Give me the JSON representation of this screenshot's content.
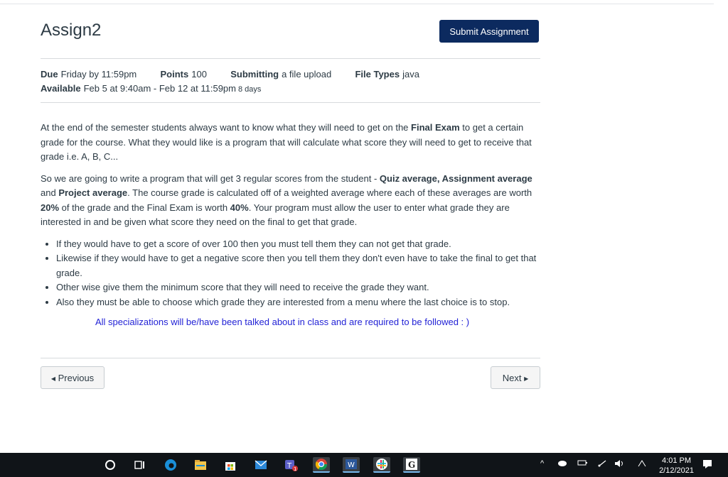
{
  "assignment": {
    "title": "Assign2",
    "submit_label": "Submit Assignment"
  },
  "details": {
    "due_label": "Due",
    "due_value": "Friday by 11:59pm",
    "points_label": "Points",
    "points_value": "100",
    "submitting_label": "Submitting",
    "submitting_value": "a file upload",
    "filetypes_label": "File Types",
    "filetypes_value": "java",
    "available_label": "Available",
    "available_value": "Feb 5 at 9:40am - Feb 12 at 11:59pm",
    "available_days": "8 days"
  },
  "body": {
    "p1_a": "At the end of the semester students always want to know what they will need to get on the ",
    "p1_b": "Final Exam",
    "p1_c": " to get a certain grade for the course. What they would like is a program that will calculate what score they will need to get to receive that grade i.e. A, B, C...",
    "p2_a": "So we are going to write a program that will get 3 regular scores from the student - ",
    "p2_b": "Quiz average, Assignment average",
    "p2_c": " and ",
    "p2_d": "Project average",
    "p2_e": ". The course grade is calculated off of a weighted average where  each of these averages are worth ",
    "p2_f": "20%",
    "p2_g": " of the grade and the Final Exam is worth ",
    "p2_h": "40%",
    "p2_i": ". Your program must allow the user to enter what grade they are interested in and be given what score they need on the final to get that grade.",
    "bullets": [
      "If they would have to get a score of over 100 then you must tell them they can not get that grade.",
      "Likewise if they would have to get a negative score then you tell them they don't even have to take the final to get that grade.",
      "Other wise give them the minimum score that they will need to receive the grade they want.",
      "Also they must be able to choose which grade they are interested from a menu where the last choice is to stop."
    ],
    "note": "All specializations will be/have been talked about in class and are required to be followed  : )"
  },
  "nav": {
    "prev_label": "Previous",
    "next_label": "Next"
  },
  "taskbar": {
    "time": "4:01 PM",
    "date": "2/12/2021",
    "icons": [
      "search-circle-icon",
      "task-view-icon",
      "edge-icon",
      "file-explorer-icon",
      "store-icon",
      "mail-icon",
      "teams-icon",
      "chrome-icon",
      "word-icon",
      "slack-icon",
      "g-app-icon"
    ]
  }
}
